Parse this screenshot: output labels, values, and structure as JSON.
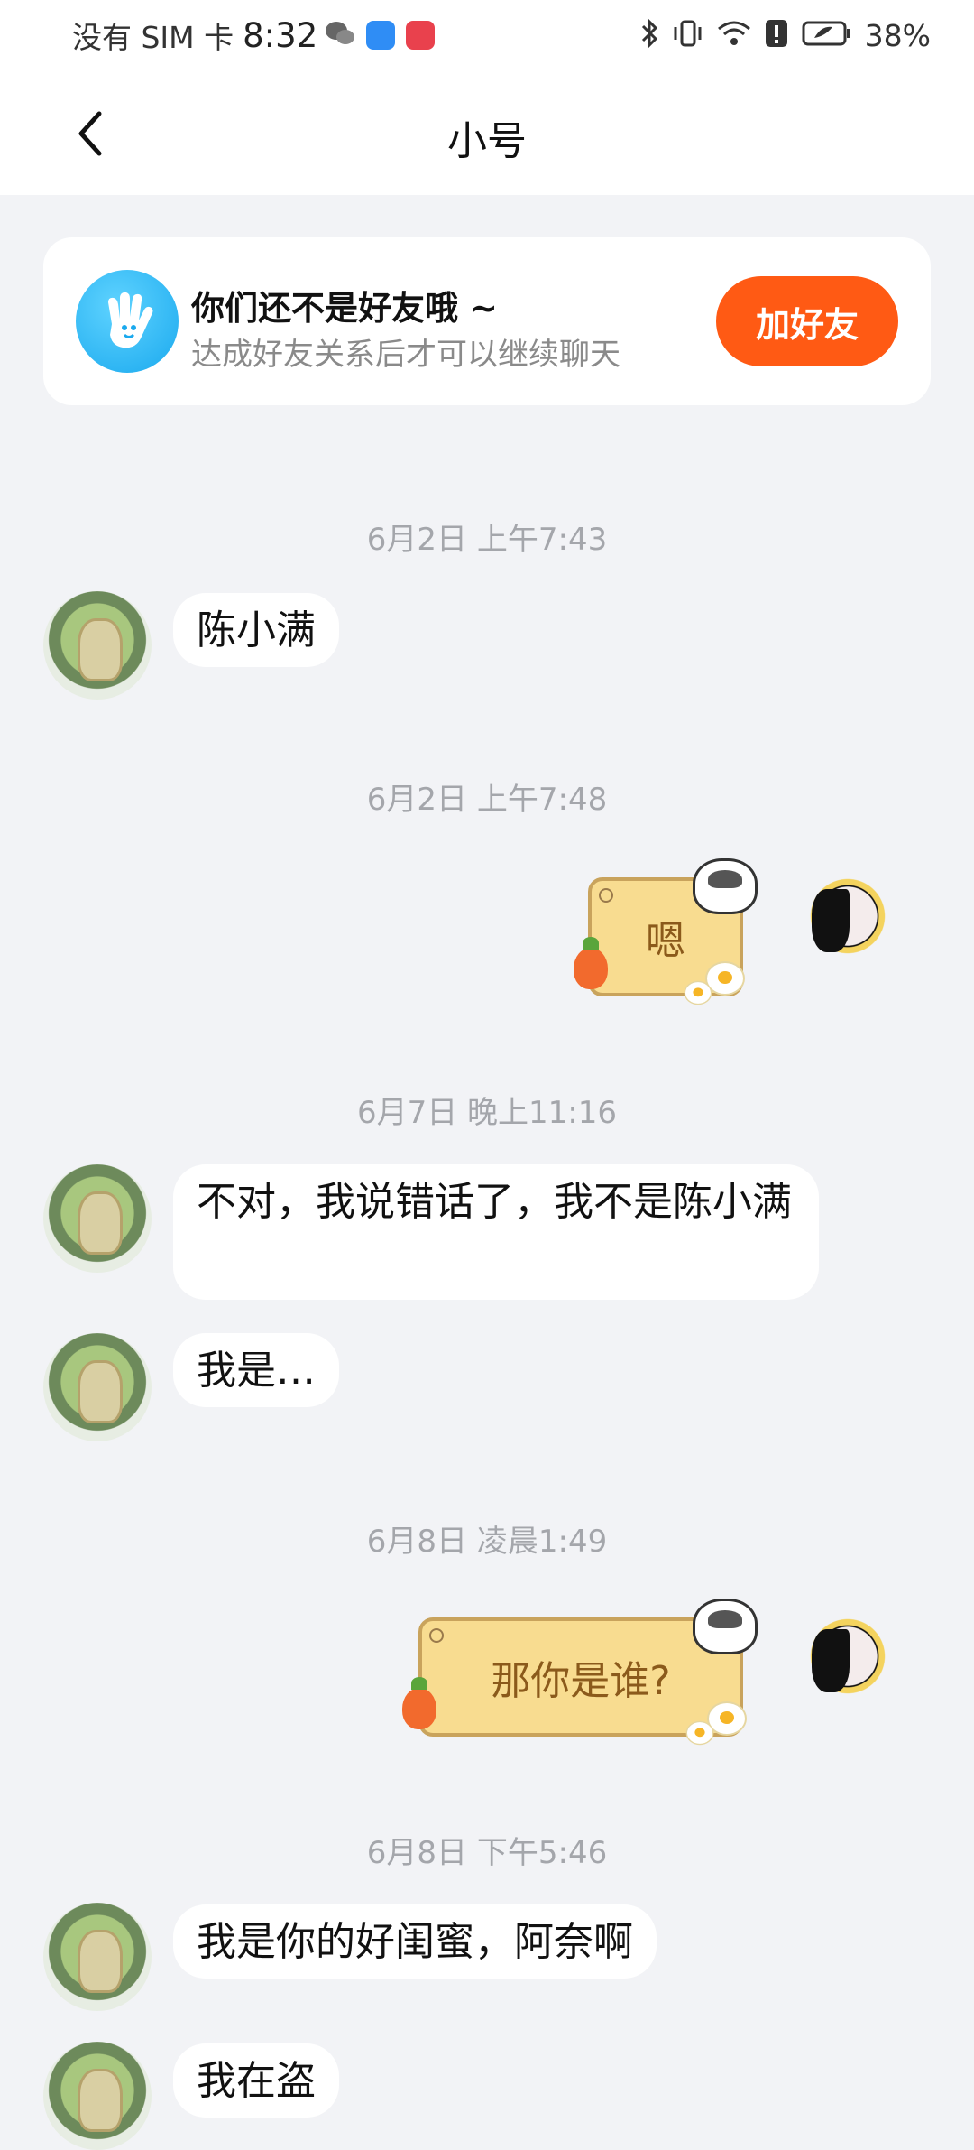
{
  "statusbar": {
    "carrier": "没有 SIM 卡",
    "time": "8:32",
    "battery": "38%"
  },
  "header": {
    "title": "小号"
  },
  "banner": {
    "title": "你们还不是好友哦 ~",
    "subtitle": "达成好友关系后才可以继续聊天",
    "add_button": "加好友"
  },
  "messages": [
    {
      "timestamp": "6月2日 上午7:43"
    },
    {
      "text": "陈小满"
    },
    {
      "timestamp": "6月2日 上午7:48"
    },
    {
      "sticker": "嗯"
    },
    {
      "timestamp": "6月7日 晚上11:16"
    },
    {
      "text": "不对，我说错话了，我不是陈小满"
    },
    {
      "text": "我是…"
    },
    {
      "timestamp": "6月8日 凌晨1:49"
    },
    {
      "sticker": "那你是谁?"
    },
    {
      "timestamp": "6月8日 下午5:46"
    },
    {
      "text": "我是你的好闺蜜，阿奈啊"
    },
    {
      "text": "我在盗"
    }
  ],
  "colors": {
    "accent": "#ff5a14",
    "background": "#f2f3f6",
    "bubble": "#ffffff",
    "sticker_fill": "#f8dc90"
  }
}
